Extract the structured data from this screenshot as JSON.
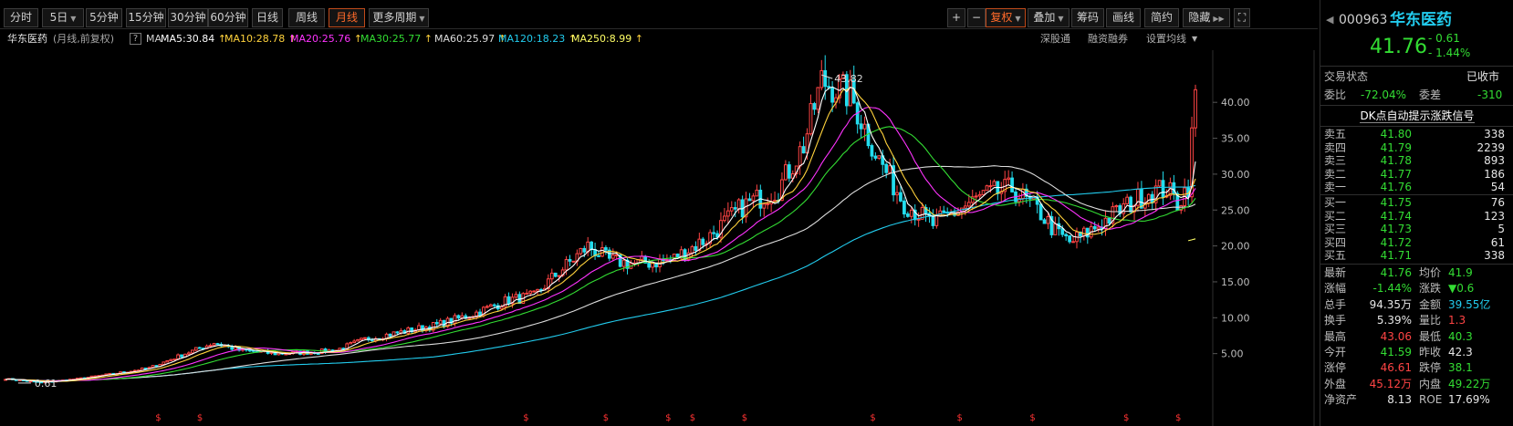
{
  "toolbar": {
    "periods": [
      "分时",
      "5日",
      "5分钟",
      "15分钟",
      "30分钟",
      "60分钟",
      "日线",
      "周线",
      "月线",
      "更多周期"
    ],
    "active_period": "月线",
    "right_buttons": [
      "+",
      "−",
      "复权",
      "叠加",
      "筹码",
      "画线",
      "简约",
      "隐藏"
    ]
  },
  "ma_bar": {
    "stock_name": "华东医药",
    "mode": "(月线,前复权)",
    "help": "?",
    "ma_label": "MA",
    "items": [
      {
        "text": "MA5:30.84",
        "color": "#ffffff"
      },
      {
        "text": "MA10:28.78",
        "color": "#ffd23c"
      },
      {
        "text": "MA20:25.76",
        "color": "#ff33ff"
      },
      {
        "text": "MA30:25.77",
        "color": "#33dd33"
      },
      {
        "text": "MA60:25.97",
        "color": "#dcdcdc"
      },
      {
        "text": "MA120:18.23",
        "color": "#22ccee"
      },
      {
        "text": "MA250:8.99",
        "color": "#ffff66"
      }
    ],
    "links": [
      "深股通",
      "融资融券",
      "设置均线"
    ]
  },
  "chart_data": {
    "type": "candlestick",
    "y_ticks": [
      "40.00",
      "35.00",
      "30.00",
      "25.00",
      "20.00",
      "15.00",
      "10.00",
      "5.00"
    ],
    "ylim": [
      0,
      45
    ],
    "high_label": "43.82",
    "low_label": "0.61",
    "colors": {
      "up": "#ff4444",
      "down": "#22ddee",
      "ma5": "#ffffff",
      "ma10": "#ffd23c",
      "ma20": "#ff33ff",
      "ma30": "#33dd33",
      "ma60": "#dcdcdc",
      "ma120": "#22ccee",
      "ma250": "#ffff66"
    },
    "anchors": [
      [
        0,
        1.5
      ],
      [
        10,
        1.0
      ],
      [
        20,
        1.5
      ],
      [
        30,
        2.2
      ],
      [
        40,
        3.0
      ],
      [
        50,
        5.0
      ],
      [
        58,
        6.5
      ],
      [
        65,
        5.5
      ],
      [
        75,
        5.0
      ],
      [
        85,
        5.2
      ],
      [
        92,
        5.5
      ],
      [
        100,
        7.0
      ],
      [
        110,
        8.0
      ],
      [
        120,
        9.0
      ],
      [
        130,
        10.5
      ],
      [
        140,
        12.5
      ],
      [
        147,
        13.0
      ],
      [
        152,
        15.5
      ],
      [
        162,
        20.0
      ],
      [
        168,
        18.0
      ],
      [
        175,
        17.5
      ],
      [
        185,
        18.0
      ],
      [
        195,
        21.0
      ],
      [
        205,
        25.5
      ],
      [
        215,
        28.0
      ],
      [
        222,
        34.0
      ],
      [
        227,
        43.0
      ],
      [
        235,
        41.0
      ],
      [
        243,
        32.0
      ],
      [
        250,
        26.0
      ],
      [
        258,
        23.0
      ],
      [
        265,
        25.0
      ],
      [
        272,
        27.0
      ],
      [
        280,
        28.0
      ],
      [
        288,
        24.5
      ],
      [
        292,
        22.0
      ],
      [
        296,
        20.5
      ],
      [
        300,
        21.5
      ],
      [
        310,
        25.0
      ],
      [
        318,
        27.5
      ],
      [
        323,
        28.0
      ],
      [
        326,
        26.0
      ],
      [
        329,
        28.5
      ],
      [
        331,
        41.76
      ]
    ],
    "signal_marks": [
      "$",
      "$",
      "$",
      "$",
      "$",
      "$",
      "$",
      "$",
      "$",
      "$",
      "$",
      "$"
    ]
  },
  "quote": {
    "code": "000963",
    "name": "华东医药",
    "price": "41.76",
    "change": "- 0.61",
    "change_pct": "- 1.44%",
    "status_label": "交易状态",
    "status_value": "已收市",
    "weibi_label": "委比",
    "weibi_value": "-72.04%",
    "weicha_label": "委差",
    "weicha_value": "-310",
    "dk_link": "DK点自动提示涨跌信号",
    "asks": [
      {
        "label": "卖五",
        "price": "41.80",
        "vol": "338"
      },
      {
        "label": "卖四",
        "price": "41.79",
        "vol": "2239"
      },
      {
        "label": "卖三",
        "price": "41.78",
        "vol": "893"
      },
      {
        "label": "卖二",
        "price": "41.77",
        "vol": "186"
      },
      {
        "label": "卖一",
        "price": "41.76",
        "vol": "54"
      }
    ],
    "bids": [
      {
        "label": "买一",
        "price": "41.75",
        "vol": "76"
      },
      {
        "label": "买二",
        "price": "41.74",
        "vol": "123"
      },
      {
        "label": "买三",
        "price": "41.73",
        "vol": "5"
      },
      {
        "label": "买四",
        "price": "41.72",
        "vol": "61"
      },
      {
        "label": "买五",
        "price": "41.71",
        "vol": "338"
      }
    ],
    "stats": [
      {
        "l1": "最新",
        "v1": "41.76",
        "c1": "green",
        "l2": "均价",
        "v2": "41.9",
        "c2": "green"
      },
      {
        "l1": "涨幅",
        "v1": "-1.44%",
        "c1": "green",
        "l2": "涨跌",
        "v2": "▼0.6",
        "c2": "green"
      },
      {
        "l1": "总手",
        "v1": "94.35万",
        "c1": "white",
        "l2": "金额",
        "v2": "39.55亿",
        "c2": "cyan"
      },
      {
        "l1": "换手",
        "v1": "5.39%",
        "c1": "white",
        "l2": "量比",
        "v2": "1.3",
        "c2": "red"
      },
      {
        "l1": "最高",
        "v1": "43.06",
        "c1": "red",
        "l2": "最低",
        "v2": "40.3",
        "c2": "green"
      },
      {
        "l1": "今开",
        "v1": "41.59",
        "c1": "green",
        "l2": "昨收",
        "v2": "42.3",
        "c2": "white"
      },
      {
        "l1": "涨停",
        "v1": "46.61",
        "c1": "red",
        "l2": "跌停",
        "v2": "38.1",
        "c2": "green"
      },
      {
        "l1": "外盘",
        "v1": "45.12万",
        "c1": "red",
        "l2": "内盘",
        "v2": "49.22万",
        "c2": "green"
      },
      {
        "l1": "净资产",
        "v1": "8.13",
        "c1": "white",
        "l2": "ROE",
        "v2": "17.69%",
        "c2": "white"
      }
    ]
  }
}
